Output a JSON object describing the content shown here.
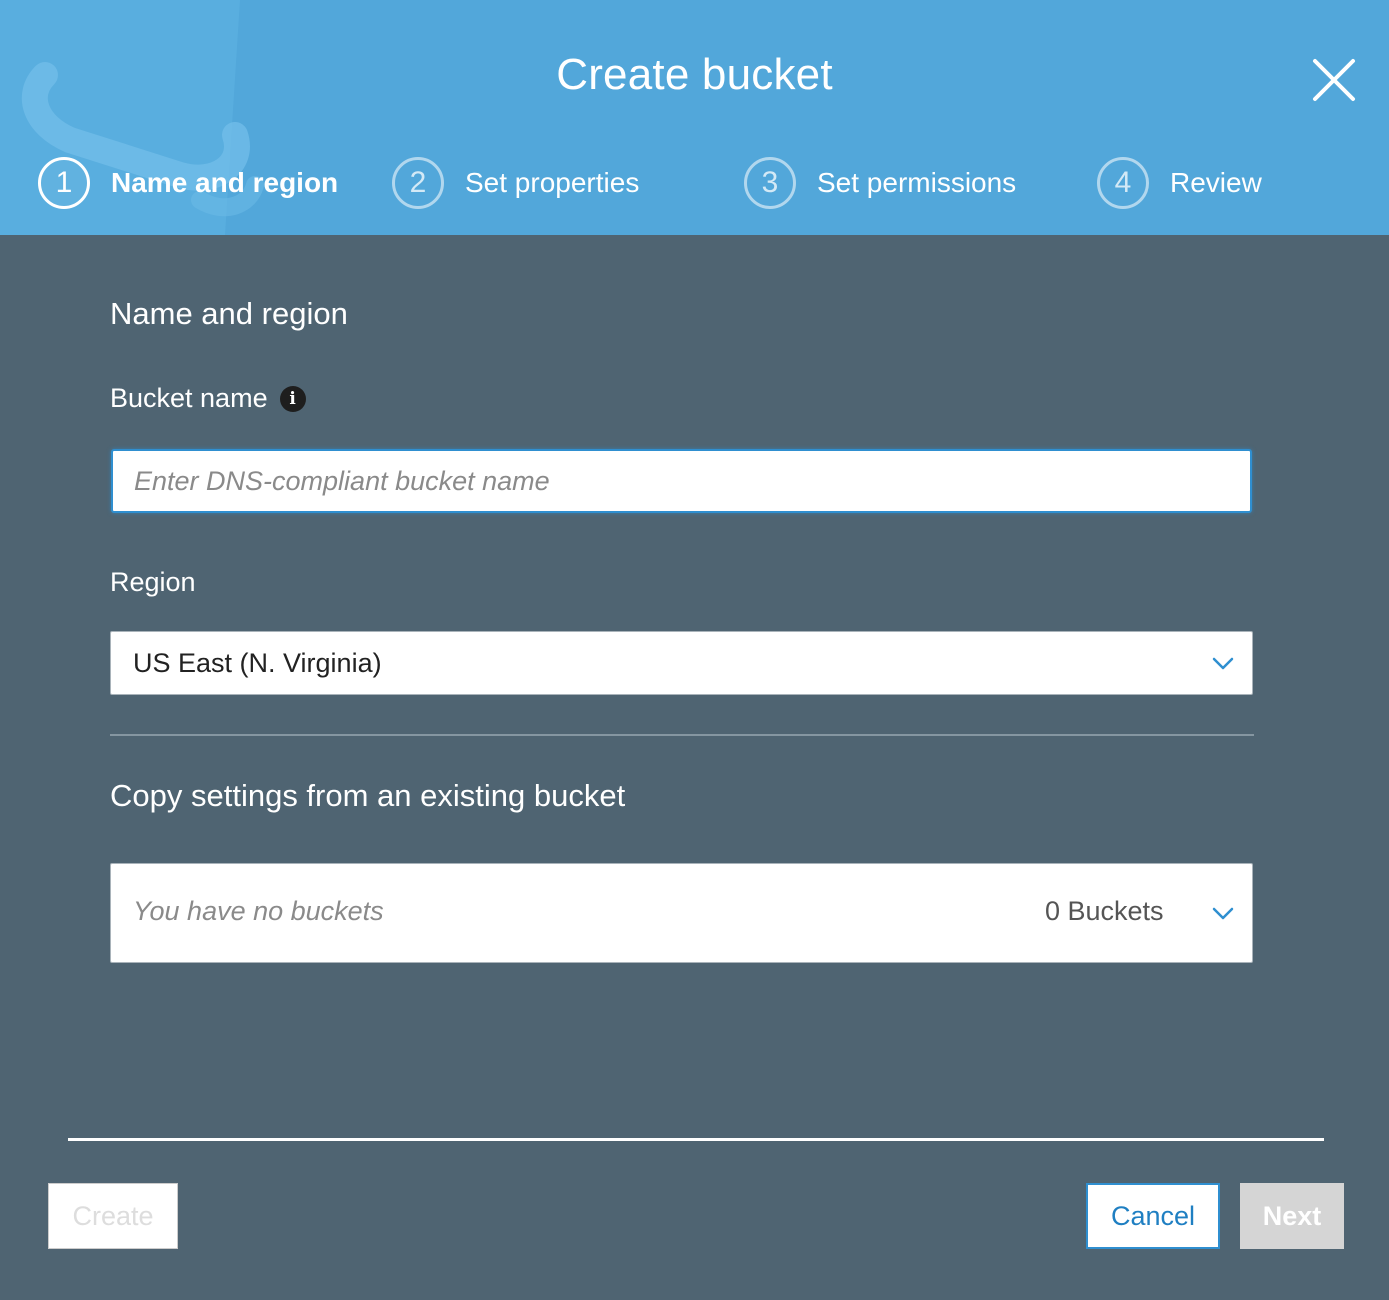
{
  "dialog": {
    "title": "Create bucket"
  },
  "steps": [
    {
      "number": "1",
      "label": "Name and region",
      "active": true
    },
    {
      "number": "2",
      "label": "Set properties",
      "active": false
    },
    {
      "number": "3",
      "label": "Set permissions",
      "active": false
    },
    {
      "number": "4",
      "label": "Review",
      "active": false
    }
  ],
  "form": {
    "section_title": "Name and region",
    "bucket_name_label": "Bucket name",
    "bucket_name_placeholder": "Enter DNS-compliant bucket name",
    "bucket_name_value": "",
    "region_label": "Region",
    "region_value": "US East (N. Virginia)",
    "copy_title": "Copy settings from an existing bucket",
    "copy_placeholder": "You have no buckets",
    "copy_count": "0 Buckets"
  },
  "footer": {
    "create_label": "Create",
    "cancel_label": "Cancel",
    "next_label": "Next"
  },
  "colors": {
    "header_bg": "#52a7da",
    "body_bg": "#4f6472",
    "accent": "#2f8fd0"
  },
  "icons": {
    "close": "close-icon",
    "info": "info-icon",
    "chevron": "chevron-down-icon"
  }
}
